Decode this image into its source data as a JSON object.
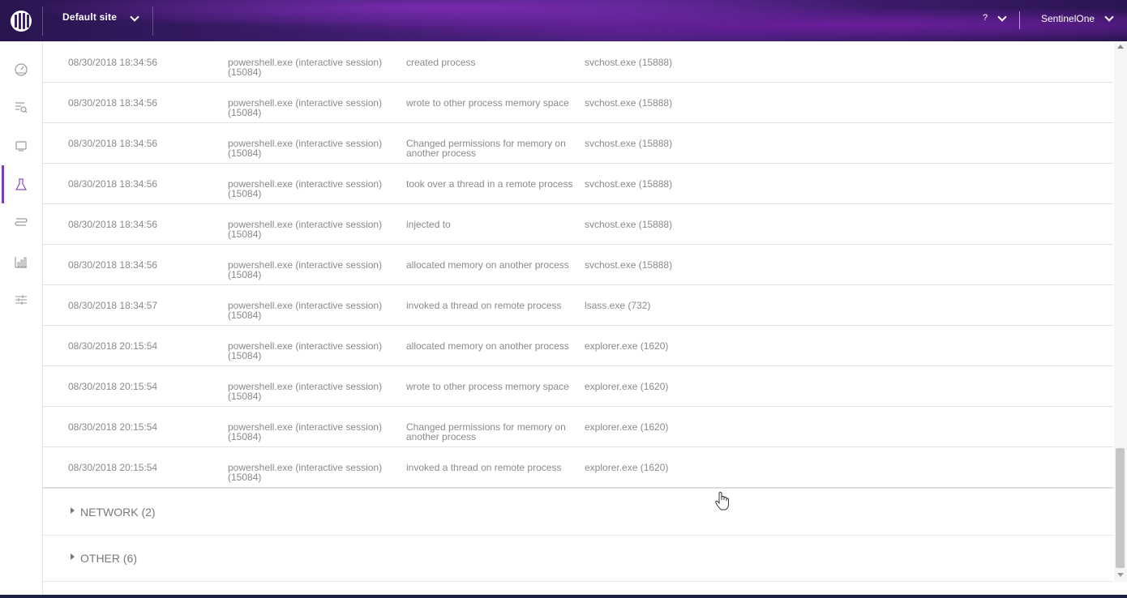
{
  "header": {
    "site_label": "Default site",
    "help_label": "?",
    "user_label": "SentinelOne"
  },
  "sidebar": {
    "items": [
      {
        "icon": "dashboard-icon"
      },
      {
        "icon": "threat-search-icon"
      },
      {
        "icon": "endpoints-icon"
      },
      {
        "icon": "lab-flask-icon",
        "active": true
      },
      {
        "icon": "routes-icon"
      },
      {
        "icon": "reports-chart-icon"
      },
      {
        "icon": "settings-sliders-icon"
      }
    ]
  },
  "events": {
    "rows": [
      {
        "time": "08/30/2018 18:34:56",
        "source": "powershell.exe (interactive session) (15084)",
        "action": "created process",
        "target": "svchost.exe (15888)"
      },
      {
        "time": "08/30/2018 18:34:56",
        "source": "powershell.exe (interactive session) (15084)",
        "action": "wrote to other process memory space",
        "target": "svchost.exe (15888)"
      },
      {
        "time": "08/30/2018 18:34:56",
        "source": "powershell.exe (interactive session) (15084)",
        "action": "Changed permissions for memory on another process",
        "target": "svchost.exe (15888)"
      },
      {
        "time": "08/30/2018 18:34:56",
        "source": "powershell.exe (interactive session) (15084)",
        "action": "took over a thread in a remote process",
        "target": "svchost.exe (15888)"
      },
      {
        "time": "08/30/2018 18:34:56",
        "source": "powershell.exe (interactive session) (15084)",
        "action": "injected to",
        "target": "svchost.exe (15888)"
      },
      {
        "time": "08/30/2018 18:34:56",
        "source": "powershell.exe (interactive session) (15084)",
        "action": "allocated memory on another process",
        "target": "svchost.exe (15888)"
      },
      {
        "time": "08/30/2018 18:34:57",
        "source": "powershell.exe (interactive session) (15084)",
        "action": "invoked a thread on remote process",
        "target": "lsass.exe (732)"
      },
      {
        "time": "08/30/2018 20:15:54",
        "source": "powershell.exe (interactive session) (15084)",
        "action": "allocated memory on another process",
        "target": "explorer.exe (1620)"
      },
      {
        "time": "08/30/2018 20:15:54",
        "source": "powershell.exe (interactive session) (15084)",
        "action": "wrote to other process memory space",
        "target": "explorer.exe (1620)"
      },
      {
        "time": "08/30/2018 20:15:54",
        "source": "powershell.exe (interactive session) (15084)",
        "action": "Changed permissions for memory on another process",
        "target": "explorer.exe (1620)"
      },
      {
        "time": "08/30/2018 20:15:54",
        "source": "powershell.exe (interactive session) (15084)",
        "action": "invoked a thread on remote process",
        "target": "explorer.exe (1620)"
      }
    ]
  },
  "sections": [
    {
      "label": "NETWORK (2)"
    },
    {
      "label": "OTHER (6)"
    }
  ]
}
